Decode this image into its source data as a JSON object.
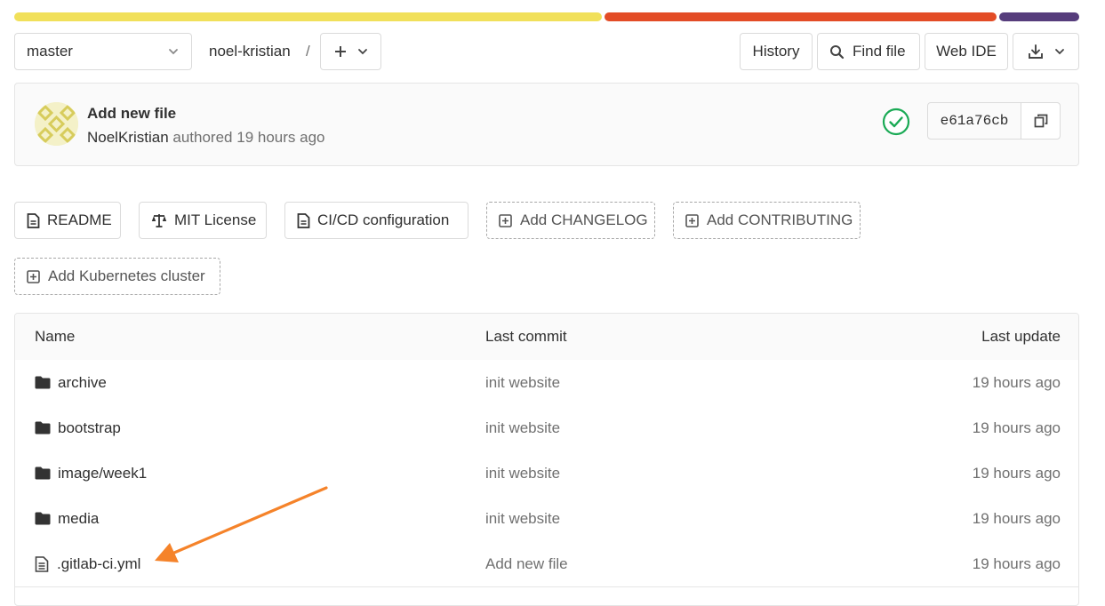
{
  "language_bar": [
    {
      "color": "#f1e05a",
      "share": 0.555
    },
    {
      "color": "#e34c26",
      "share": 0.37
    },
    {
      "color": "#563d7c",
      "share": 0.075
    }
  ],
  "toolbar": {
    "branch": "master",
    "project": "noel-kristian",
    "separator": "/",
    "history_label": "History",
    "find_file_label": "Find file",
    "web_ide_label": "Web IDE"
  },
  "commit": {
    "title": "Add new file",
    "author": "NoelKristian",
    "authored_text": "authored",
    "time": "19 hours ago",
    "sha": "e61a76cb",
    "status_color": "#1aaa55"
  },
  "shortcuts": [
    {
      "label": "README",
      "icon": "document-icon",
      "style": "solid"
    },
    {
      "label": "MIT License",
      "icon": "scale-icon",
      "style": "solid"
    },
    {
      "label": "CI/CD configuration",
      "icon": "document-icon",
      "style": "solid"
    },
    {
      "label": "Add CHANGELOG",
      "icon": "plus-square-icon",
      "style": "dashed"
    },
    {
      "label": "Add CONTRIBUTING",
      "icon": "plus-square-icon",
      "style": "dashed"
    },
    {
      "label": "Add Kubernetes cluster",
      "icon": "plus-square-icon",
      "style": "dashed"
    }
  ],
  "table": {
    "headers": {
      "name": "Name",
      "last_commit": "Last commit",
      "last_update": "Last update"
    },
    "rows": [
      {
        "name": "archive",
        "type": "folder",
        "commit": "init website",
        "updated": "19 hours ago"
      },
      {
        "name": "bootstrap",
        "type": "folder",
        "commit": "init website",
        "updated": "19 hours ago"
      },
      {
        "name": "image/week1",
        "type": "folder",
        "commit": "init website",
        "updated": "19 hours ago"
      },
      {
        "name": "media",
        "type": "folder",
        "commit": "init website",
        "updated": "19 hours ago"
      },
      {
        "name": ".gitlab-ci.yml",
        "type": "file",
        "commit": "Add new file",
        "updated": "19 hours ago"
      }
    ]
  },
  "annotation": {
    "arrow_color": "#f5832a",
    "points_to": ".gitlab-ci.yml"
  }
}
